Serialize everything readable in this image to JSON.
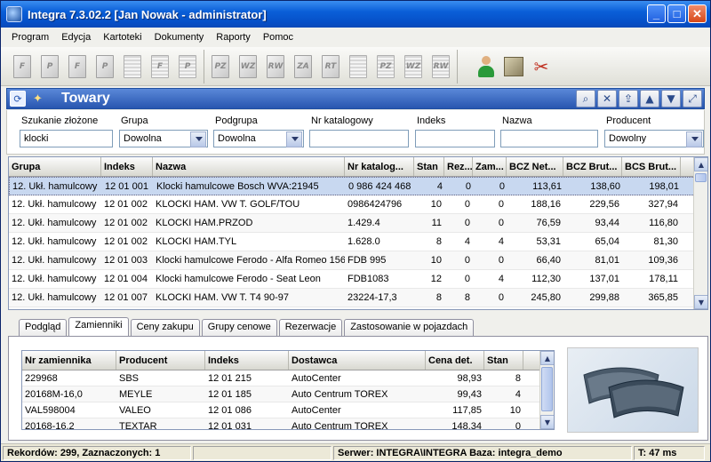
{
  "window": {
    "title": "Integra 7.3.02.2 [Jan Nowak - administrator]"
  },
  "menu": [
    "Program",
    "Edycja",
    "Kartoteki",
    "Dokumenty",
    "Raporty",
    "Pomoc"
  ],
  "toolbar": {
    "group1": [
      "F",
      "P",
      "F",
      "P",
      "",
      "F",
      "P"
    ],
    "group2": [
      "PZ",
      "WZ",
      "RW",
      "ZA",
      "RT",
      "",
      "PZ",
      "WZ",
      "RW"
    ]
  },
  "section": {
    "title": "Towary"
  },
  "filters": {
    "szukanie_label": "Szukanie złożone",
    "szukanie_value": "klocki",
    "grupa_label": "Grupa",
    "grupa_value": "Dowolna",
    "podgrupa_label": "Podgrupa",
    "podgrupa_value": "Dowolna",
    "nrkat_label": "Nr katalogowy",
    "nrkat_value": "",
    "indeks_label": "Indeks",
    "indeks_value": "",
    "nazwa_label": "Nazwa",
    "nazwa_value": "",
    "producent_label": "Producent",
    "producent_value": "Dowolny"
  },
  "grid": {
    "headers": [
      "Grupa",
      "Indeks",
      "Nazwa",
      "Nr katalog...",
      "Stan",
      "Rez...",
      "Zam...",
      "BCZ Net...",
      "BCZ Brut...",
      "BCS Brut..."
    ],
    "rows": [
      [
        "12. Ukł. hamulcowy",
        "12 01 001",
        "Klocki hamulcowe Bosch WVA:21945",
        "0 986 424 468",
        "4",
        "0",
        "0",
        "113,61",
        "138,60",
        "198,01"
      ],
      [
        "12. Ukł. hamulcowy",
        "12 01 002",
        "KLOCKI HAM. VW T. GOLF/TOU",
        "0986424796",
        "10",
        "0",
        "0",
        "188,16",
        "229,56",
        "327,94"
      ],
      [
        "12. Ukł. hamulcowy",
        "12 01 002",
        "KLOCKI HAM.PRZOD",
        "1.429.4",
        "11",
        "0",
        "0",
        "76,59",
        "93,44",
        "116,80"
      ],
      [
        "12. Ukł. hamulcowy",
        "12 01 002",
        "KLOCKI HAM.TYL",
        "1.628.0",
        "8",
        "4",
        "4",
        "53,31",
        "65,04",
        "81,30"
      ],
      [
        "12. Ukł. hamulcowy",
        "12 01 003",
        "Klocki hamulcowe Ferodo - Alfa Romeo 156",
        "FDB 995",
        "10",
        "0",
        "0",
        "66,40",
        "81,01",
        "109,36"
      ],
      [
        "12. Ukł. hamulcowy",
        "12 01 004",
        "Klocki hamulcowe Ferodo - Seat Leon",
        "FDB1083",
        "12",
        "0",
        "4",
        "112,30",
        "137,01",
        "178,11"
      ],
      [
        "12. Ukł. hamulcowy",
        "12 01 007",
        "KLOCKI HAM. VW T. T4 90-97",
        "23224-17,3",
        "8",
        "8",
        "0",
        "245,80",
        "299,88",
        "365,85"
      ]
    ]
  },
  "tabs": [
    "Podgląd",
    "Zamienniki",
    "Ceny zakupu",
    "Grupy cenowe",
    "Rezerwacje",
    "Zastosowanie w pojazdach"
  ],
  "subgrid": {
    "headers": [
      "Nr zamiennika",
      "Producent",
      "Indeks",
      "Dostawca",
      "Cena det.",
      "Stan"
    ],
    "rows": [
      [
        "229968",
        "SBS",
        "12 01 215",
        "AutoCenter",
        "98,93",
        "8"
      ],
      [
        "20168M-16,0",
        "MEYLE",
        "12 01 185",
        "Auto Centrum TOREX",
        "99,43",
        "4"
      ],
      [
        "VAL598004",
        "VALEO",
        "12 01 086",
        "AutoCenter",
        "117,85",
        "10"
      ],
      [
        "20168-16,2",
        "TEXTAR",
        "12 01 031",
        "Auto Centrum TOREX",
        "148,34",
        "0"
      ]
    ]
  },
  "status": {
    "records": "Rekordów: 299, Zaznaczonych: 1",
    "server": "Serwer: INTEGRA\\INTEGRA  Baza: integra_demo",
    "time": "T: 47 ms"
  },
  "colors": {
    "titlebar": "#0a5fd8",
    "section_header": "#2856b0",
    "selected_row": "#c8d8f0"
  }
}
